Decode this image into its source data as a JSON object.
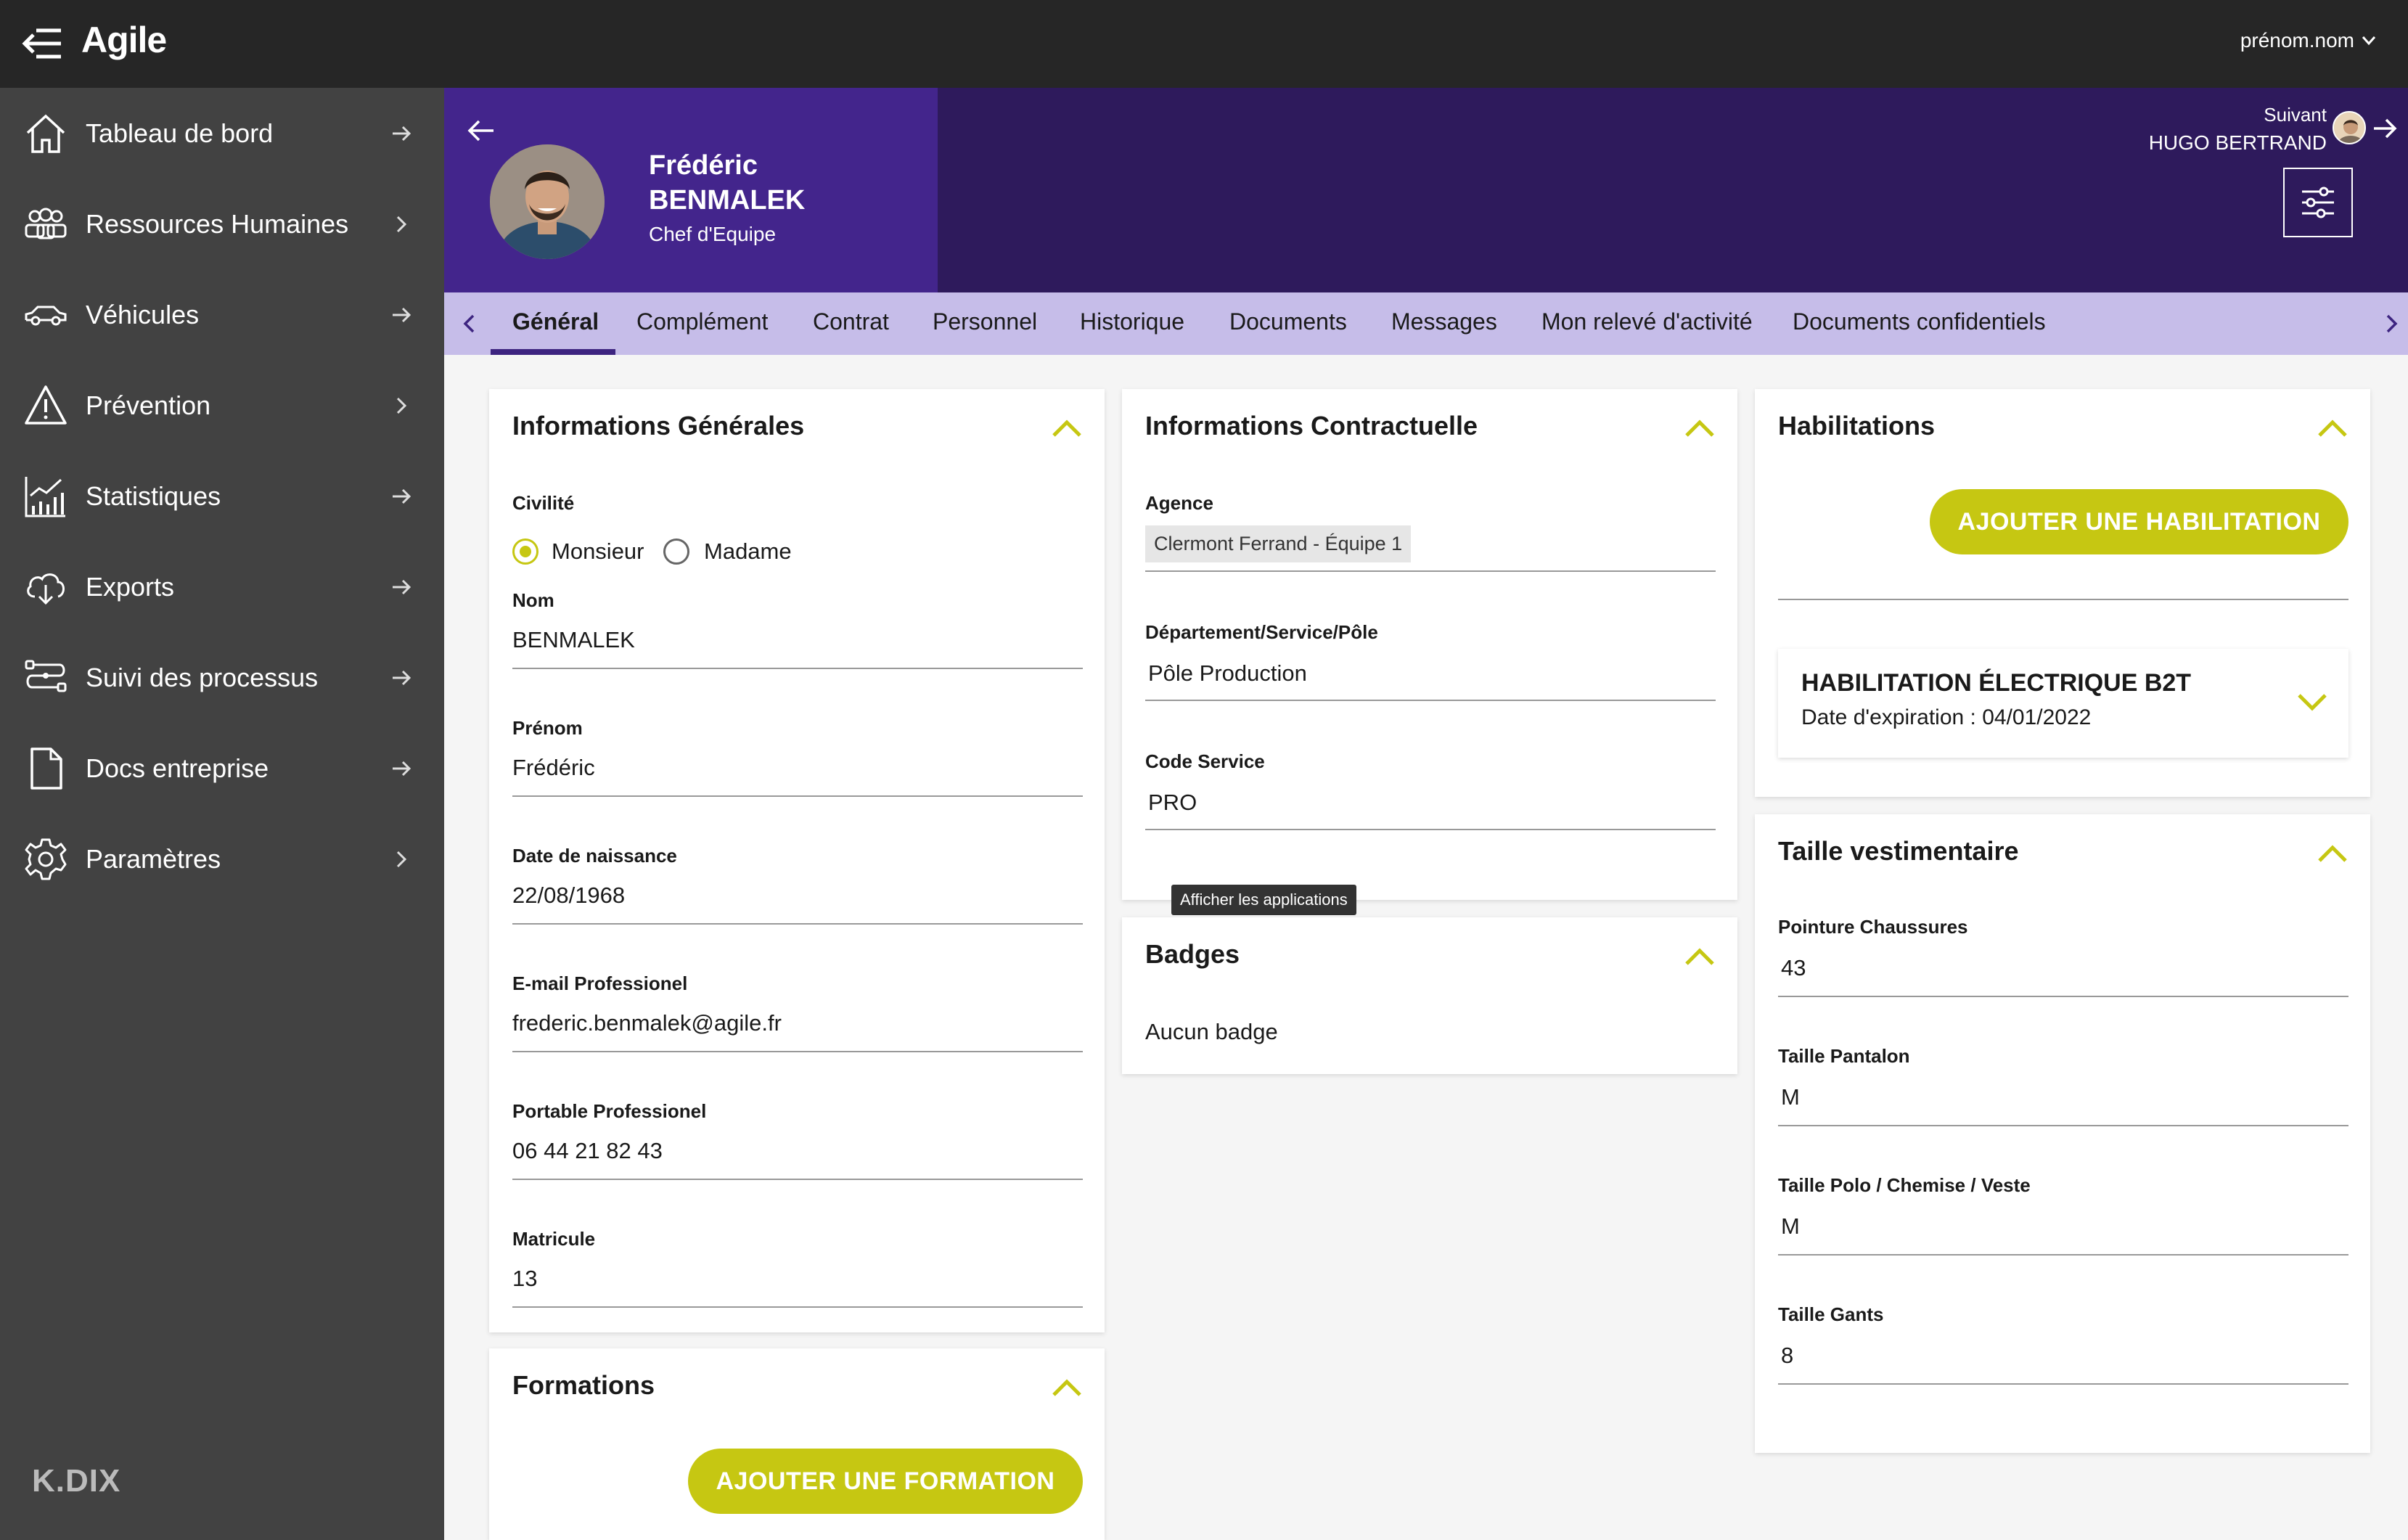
{
  "app": {
    "brand": "Agile",
    "user": "prénom.nom",
    "footer_logo": "K.DIX"
  },
  "sidebar": {
    "items": [
      {
        "label": "Tableau de bord",
        "icon": "home-icon"
      },
      {
        "label": "Ressources Humaines",
        "icon": "people-icon"
      },
      {
        "label": "Véhicules",
        "icon": "car-icon"
      },
      {
        "label": "Prévention",
        "icon": "warning-icon"
      },
      {
        "label": "Statistiques",
        "icon": "chart-icon"
      },
      {
        "label": "Exports",
        "icon": "cloud-download-icon"
      },
      {
        "label": "Suivi des processus",
        "icon": "process-icon"
      },
      {
        "label": "Docs entreprise",
        "icon": "document-icon"
      },
      {
        "label": "Paramètres",
        "icon": "gear-icon"
      }
    ]
  },
  "profile": {
    "first_name": "Frédéric",
    "last_name": "BENMALEK",
    "role": "Chef d'Equipe"
  },
  "next": {
    "label": "Suivant",
    "name": "HUGO BERTRAND"
  },
  "tabs": [
    "Général",
    "Complément",
    "Contrat",
    "Personnel",
    "Historique",
    "Documents",
    "Messages",
    "Mon relevé d'activité",
    "Documents confidentiels"
  ],
  "general": {
    "title": "Informations Générales",
    "civility_label": "Civilité",
    "civility_options": [
      "Monsieur",
      "Madame"
    ],
    "civility_selected": "Monsieur",
    "fields": [
      {
        "label": "Nom",
        "value": "BENMALEK"
      },
      {
        "label": "Prénom",
        "value": "Frédéric"
      },
      {
        "label": "Date de naissance",
        "value": "22/08/1968"
      },
      {
        "label": "E-mail Professionel",
        "value": "frederic.benmalek@agile.fr"
      },
      {
        "label": "Portable Professionel",
        "value": "06 44 21 82 43"
      },
      {
        "label": "Matricule",
        "value": "13"
      }
    ]
  },
  "formations": {
    "title": "Formations",
    "add_button": "AJOUTER UNE FORMATION"
  },
  "contract": {
    "title": "Informations Contractuelle",
    "agency_label": "Agence",
    "agency_value": "Clermont Ferrand - Équipe 1",
    "fields": [
      {
        "label": "Département/Service/Pôle",
        "value": "Pôle Production"
      },
      {
        "label": "Code Service",
        "value": "PRO"
      }
    ],
    "tooltip": "Afficher les applications"
  },
  "badges": {
    "title": "Badges",
    "empty": "Aucun badge"
  },
  "habilitations": {
    "title": "Habilitations",
    "add_button": "AJOUTER UNE HABILITATION",
    "item_title": "HABILITATION ÉLECTRIQUE B2T",
    "item_subtitle": "Date d'expiration : 04/01/2022"
  },
  "clothing": {
    "title": "Taille vestimentaire",
    "fields": [
      {
        "label": "Pointure Chaussures",
        "value": "43"
      },
      {
        "label": "Taille Pantalon",
        "value": "M"
      },
      {
        "label": "Taille Polo / Chemise / Veste",
        "value": "M"
      },
      {
        "label": "Taille Gants",
        "value": "8"
      }
    ]
  },
  "colors": {
    "accent": "#c6c712",
    "header_dark": "#2e1a5c",
    "header_light": "#43258c",
    "tabs_bg": "#c6bde9",
    "sidebar": "#424242",
    "topbar": "#262626"
  }
}
